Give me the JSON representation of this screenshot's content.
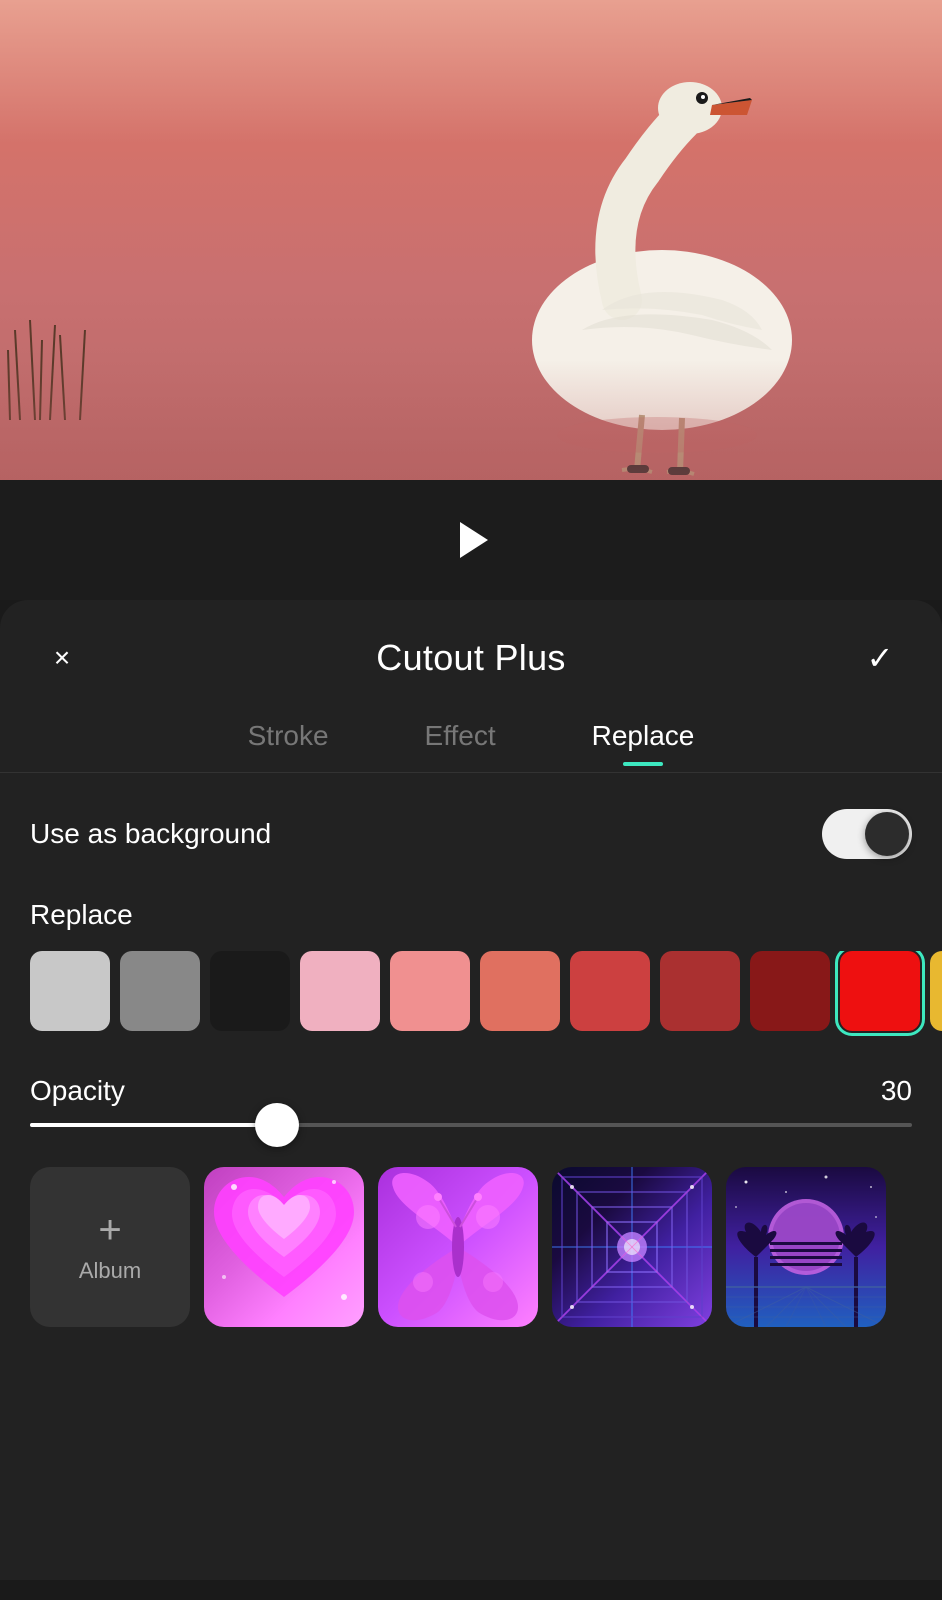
{
  "app": {
    "title": "Cutout Plus"
  },
  "header": {
    "close_label": "×",
    "title": "Cutout Plus",
    "confirm_label": "✓"
  },
  "tabs": [
    {
      "id": "stroke",
      "label": "Stroke",
      "active": false
    },
    {
      "id": "effect",
      "label": "Effect",
      "active": false
    },
    {
      "id": "replace",
      "label": "Replace",
      "active": true
    }
  ],
  "background_toggle": {
    "label": "Use as background",
    "enabled": true
  },
  "replace_section": {
    "label": "Replace",
    "colors": [
      {
        "id": "light-gray",
        "hex": "#c8c8c8",
        "selected": false
      },
      {
        "id": "mid-gray",
        "hex": "#888888",
        "selected": false
      },
      {
        "id": "black",
        "hex": "#1a1a1a",
        "selected": false
      },
      {
        "id": "light-pink",
        "hex": "#f0b0c0",
        "selected": false
      },
      {
        "id": "pink",
        "hex": "#f09090",
        "selected": false
      },
      {
        "id": "salmon",
        "hex": "#e07060",
        "selected": false
      },
      {
        "id": "coral-red",
        "hex": "#cc4040",
        "selected": false
      },
      {
        "id": "dark-red",
        "hex": "#aa3030",
        "selected": false
      },
      {
        "id": "crimson",
        "hex": "#881818",
        "selected": false
      },
      {
        "id": "bright-red",
        "hex": "#ee1010",
        "selected": true
      },
      {
        "id": "golden",
        "hex": "#e8b830",
        "selected": false
      }
    ]
  },
  "opacity": {
    "label": "Opacity",
    "value": 30,
    "slider_pct": 28
  },
  "presets": [
    {
      "id": "album",
      "type": "album",
      "plus": "+",
      "label": "Album"
    },
    {
      "id": "hearts",
      "type": "hearts",
      "label": "Hearts"
    },
    {
      "id": "butterfly",
      "type": "butterfly",
      "label": "Butterfly"
    },
    {
      "id": "neon-tunnel",
      "type": "neon-tunnel",
      "label": "Neon Tunnel"
    },
    {
      "id": "vaporwave",
      "type": "vaporwave",
      "label": "Vaporwave"
    }
  ],
  "icons": {
    "play": "▶",
    "close": "×",
    "confirm": "✓",
    "plus": "+"
  }
}
